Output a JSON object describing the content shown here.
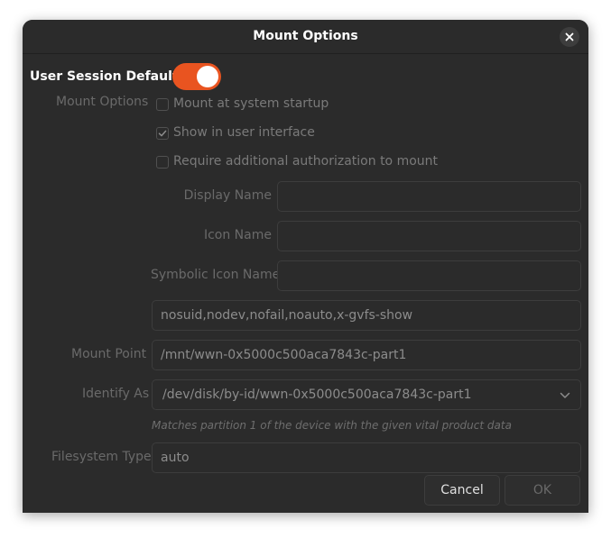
{
  "dialog": {
    "title": "Mount Options"
  },
  "session": {
    "label": "User Session Defaults",
    "enabled": true
  },
  "mount_options": {
    "label": "Mount Options",
    "checkboxes": [
      {
        "label": "Mount at system startup",
        "checked": false
      },
      {
        "label": "Show in user interface",
        "checked": true
      },
      {
        "label": "Require additional authorization to mount",
        "checked": false
      }
    ]
  },
  "fields": {
    "display_name": {
      "label": "Display Name",
      "value": ""
    },
    "icon_name": {
      "label": "Icon Name",
      "value": ""
    },
    "symbolic_icon_name": {
      "label": "Symbolic Icon Name",
      "value": ""
    },
    "options": {
      "value": "nosuid,nodev,nofail,noauto,x-gvfs-show"
    },
    "mount_point": {
      "label": "Mount Point",
      "value": "/mnt/wwn-0x5000c500aca7843c-part1"
    },
    "identify_as": {
      "label": "Identify As",
      "value": "/dev/disk/by-id/wwn-0x5000c500aca7843c-part1",
      "hint": "Matches partition 1 of the device with the given vital product data"
    },
    "filesystem_type": {
      "label": "Filesystem Type",
      "value": "auto"
    }
  },
  "buttons": {
    "cancel": "Cancel",
    "ok": "OK"
  },
  "colors": {
    "accent": "#e95420",
    "background": "#2b2b2b"
  }
}
